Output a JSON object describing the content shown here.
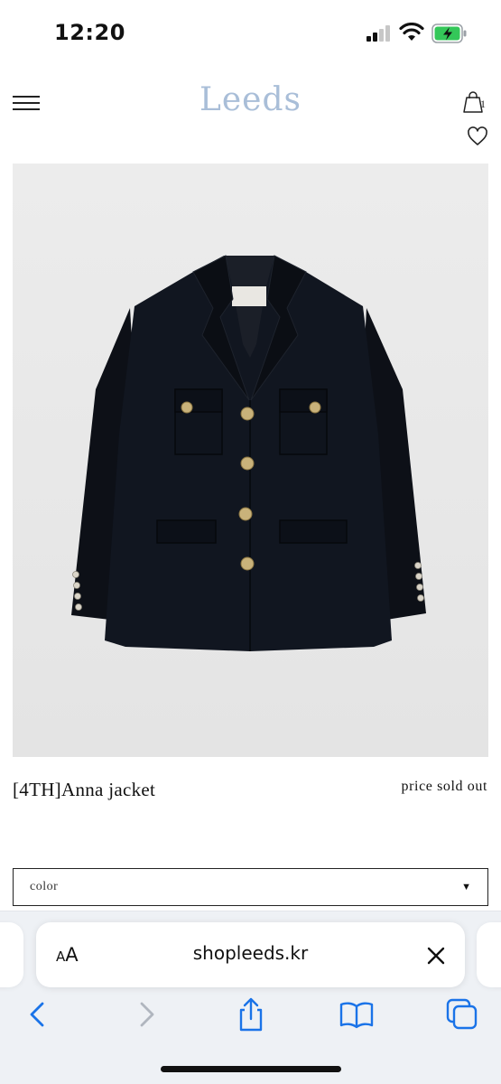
{
  "status_bar": {
    "time": "12:20"
  },
  "header": {
    "logo": "Leeds",
    "cart_count": "1",
    "logo_color": "#a9bed8"
  },
  "product": {
    "name": "[4TH]Anna jacket",
    "price": "price sold out",
    "color_select": {
      "label": "color",
      "arrow": "▼"
    }
  },
  "browser": {
    "aa_small": "A",
    "aa_large": "A",
    "url": "shopleeds.kr",
    "accent_color": "#1a73e8",
    "toolbar": [
      "back-icon",
      "forward-icon",
      "share-icon",
      "bookmarks-icon",
      "tabs-icon"
    ]
  }
}
